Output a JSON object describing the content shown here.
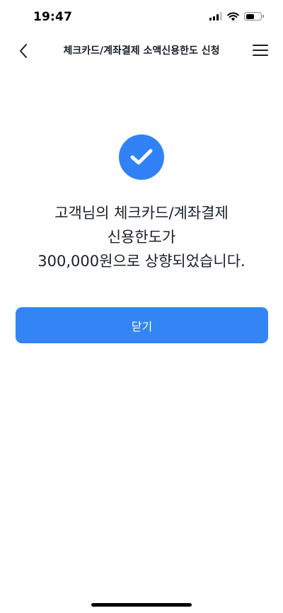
{
  "status_bar": {
    "time": "19:47",
    "icons": [
      "signal-icon",
      "wifi-icon",
      "battery-icon"
    ]
  },
  "header": {
    "back_icon": "chevron-left-icon",
    "title": "체크카드/계좌결제 소액신용한도 신청",
    "menu_icon": "hamburger-menu-icon"
  },
  "result": {
    "icon": "check-icon",
    "accent_color": "#3182f6",
    "line1": "고객님의 체크카드/계좌결제",
    "line2": "신용한도가",
    "line3": "300,000원으로 상향되었습니다."
  },
  "actions": {
    "close_label": "닫기",
    "button_color": "#3384f4"
  }
}
